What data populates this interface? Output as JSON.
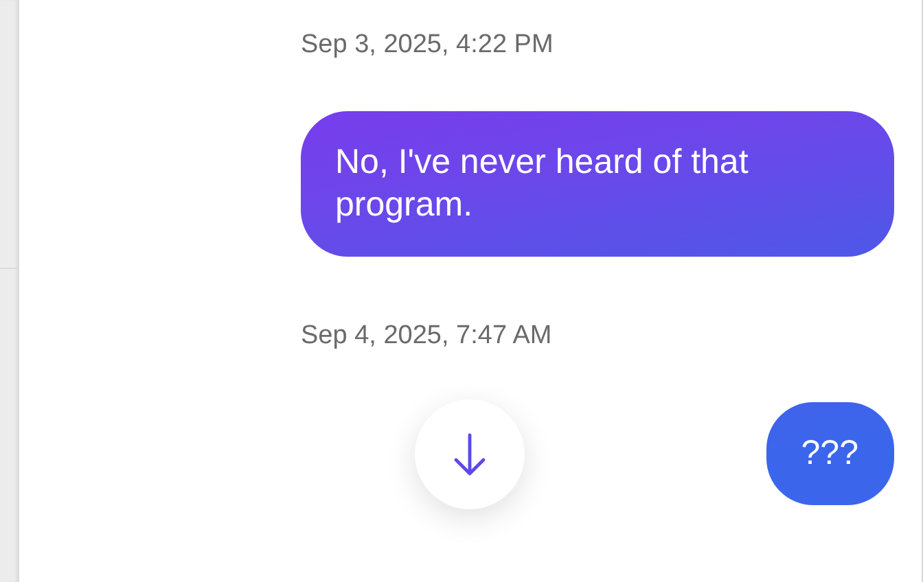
{
  "conversation": [
    {
      "kind": "timestamp",
      "text": "Sep 3, 2025, 4:22 PM"
    },
    {
      "kind": "message",
      "text": "No, I've never heard of that program."
    },
    {
      "kind": "timestamp",
      "text": "Sep 4, 2025, 7:47 AM"
    },
    {
      "kind": "message",
      "text": "???"
    }
  ]
}
